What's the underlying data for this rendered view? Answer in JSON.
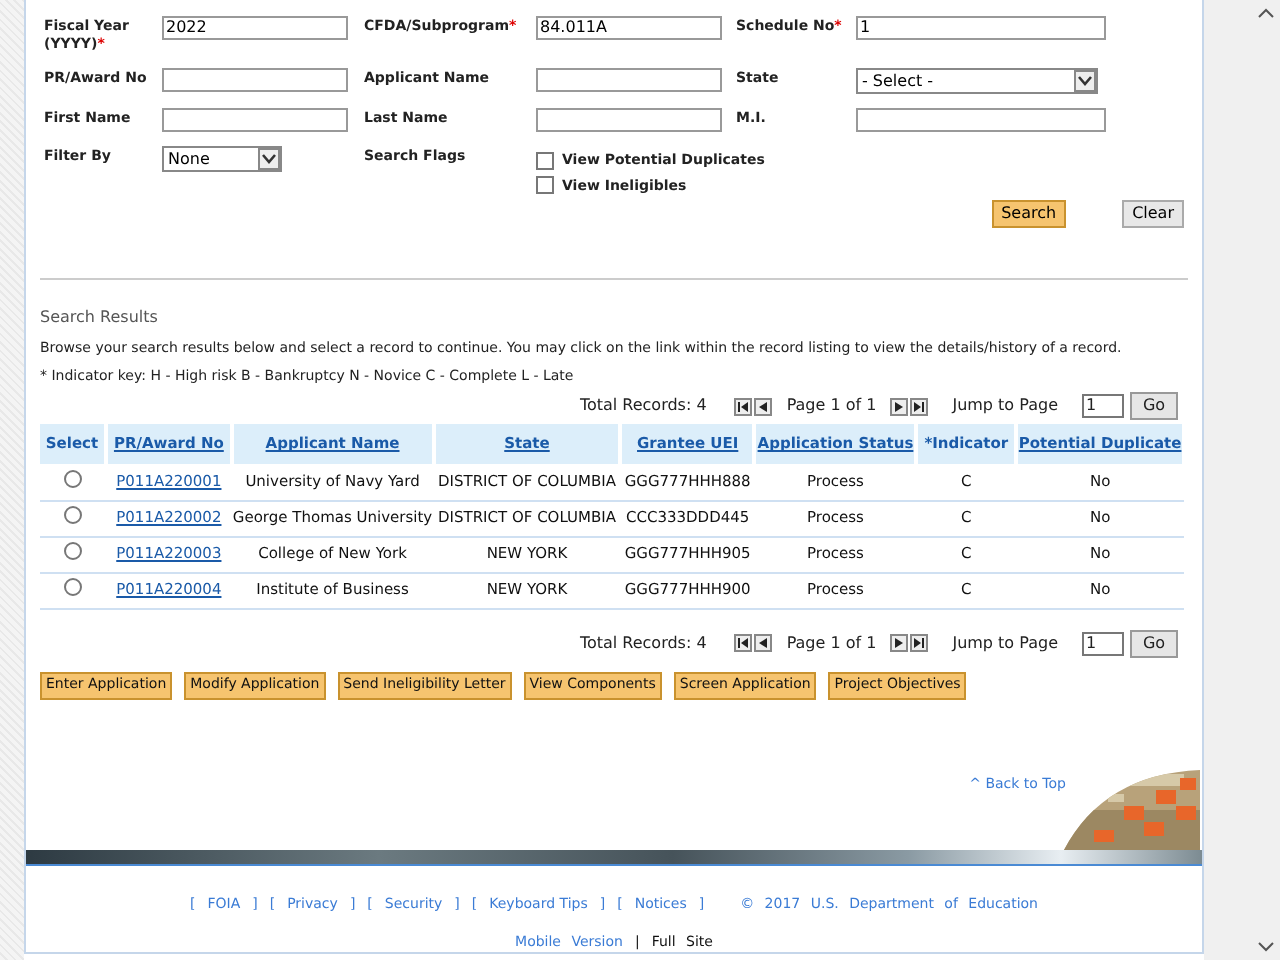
{
  "form": {
    "rows": [
      [
        {
          "label": "Fiscal Year (YYYY)",
          "required_mark": "*",
          "kind": "text",
          "value": "2022"
        },
        {
          "label": "CFDA/Subprogram",
          "required_mark": "*",
          "kind": "text",
          "value": "84.011A"
        },
        {
          "label": "Schedule No",
          "required_mark": "*",
          "kind": "text",
          "value": "1"
        }
      ],
      [
        {
          "label": "PR/Award No",
          "kind": "text"
        },
        {
          "label": "Applicant Name",
          "kind": "text"
        },
        {
          "label": "State",
          "kind": "select",
          "value": "- Select -"
        }
      ],
      [
        {
          "label": "First Name",
          "kind": "text"
        },
        {
          "label": "Last Name",
          "kind": "text"
        },
        {
          "label": "M.I.",
          "kind": "text"
        }
      ],
      [
        {
          "label": "Filter By",
          "kind": "select",
          "value": "None"
        },
        {
          "label": "Search Flags",
          "kind": "checks",
          "options": [
            {
              "label": "View Potential Duplicates",
              "checked": false
            },
            {
              "label": "View Ineligibles",
              "checked": false
            }
          ]
        }
      ]
    ],
    "buttons": [
      {
        "label": "Search",
        "primary": true
      },
      {
        "label": "Clear",
        "primary": false
      }
    ]
  },
  "results": {
    "title": "Search Results",
    "intro": "Browse your search results below and select a record to continue. You may click on the link within the record listing to view the details/history of a record.",
    "key": "* Indicator key: H - High risk B - Bankruptcy N - Novice C - Complete L - Late",
    "pagers": [
      {
        "total": "Total Records: 4",
        "page": "Page 1 of 1",
        "jump_label": "Jump to Page",
        "jump_value": "1",
        "go": "Go"
      },
      {
        "total": "Total Records: 4",
        "page": "Page 1 of 1",
        "jump_label": "Jump to Page",
        "jump_value": "1",
        "go": "Go"
      }
    ],
    "columns": [
      {
        "label": "Select",
        "link": false
      },
      {
        "label": "PR/Award No",
        "link": true
      },
      {
        "label": "Applicant Name",
        "link": true
      },
      {
        "label": "State",
        "link": true
      },
      {
        "label": "Grantee UEI",
        "link": true
      },
      {
        "label": "Application Status",
        "link": true
      },
      {
        "label": "*Indicator",
        "link": false
      },
      {
        "label": "Potential Duplicate",
        "link": true
      }
    ],
    "rows": [
      {
        "selected": false,
        "award": "P011A220001",
        "applicant": "University of Navy Yard",
        "state": "DISTRICT OF COLUMBIA",
        "uei": "GGG777HHH888",
        "status": "Process",
        "indicator": "C",
        "duplicate": "No"
      },
      {
        "selected": false,
        "award": "P011A220002",
        "applicant": "George Thomas University",
        "state": "DISTRICT OF COLUMBIA",
        "uei": "CCC333DDD445",
        "status": "Process",
        "indicator": "C",
        "duplicate": "No"
      },
      {
        "selected": false,
        "award": "P011A220003",
        "applicant": "College of New York",
        "state": "NEW YORK",
        "uei": "GGG777HHH905",
        "status": "Process",
        "indicator": "C",
        "duplicate": "No"
      },
      {
        "selected": false,
        "award": "P011A220004",
        "applicant": "Institute of Business",
        "state": "NEW YORK",
        "uei": "GGG777HHH900",
        "status": "Process",
        "indicator": "C",
        "duplicate": "No"
      }
    ],
    "actions": [
      "Enter Application",
      "Modify Application",
      "Send Ineligibility Letter",
      "View Components",
      "Screen Application",
      "Project Objectives"
    ]
  },
  "back_to_top": "^ Back to Top",
  "footer": {
    "open": "[",
    "close": "]",
    "links": [
      "FOIA",
      "Privacy",
      "Security",
      "Keyboard Tips",
      "Notices"
    ],
    "copyright": "© 2017 U.S. Department of Education",
    "mobile": "Mobile Version",
    "separator": "|",
    "full": "Full Site"
  }
}
